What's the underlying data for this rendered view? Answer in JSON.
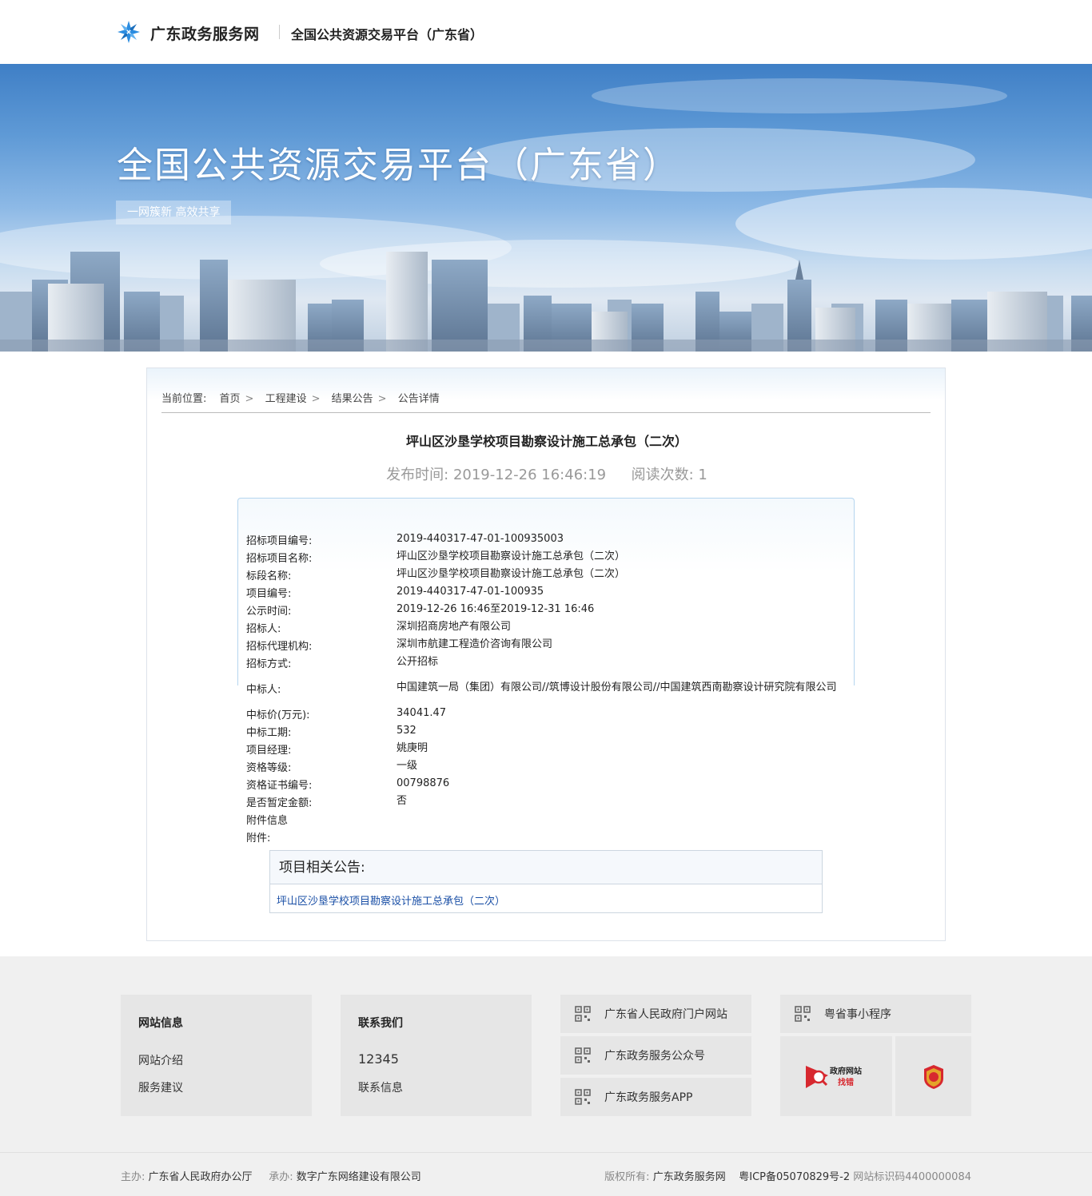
{
  "header": {
    "brand": "广东政务服务网",
    "platform": "全国公共资源交易平台（广东省）"
  },
  "banner": {
    "title": "全国公共资源交易平台（广东省）",
    "tagline": "一网簇新 高效共享"
  },
  "breadcrumb": {
    "prefix": "当前位置:",
    "items": [
      "首页",
      "工程建设",
      "结果公告",
      "公告详情"
    ],
    "separator": ">"
  },
  "notice": {
    "title": "坪山区沙垦学校项目勘察设计施工总承包（二次）",
    "publish_label": "发布时间:",
    "publish_time": "2019-12-26 16:46:19",
    "reads_label": "阅读次数:",
    "reads": "1",
    "fields": [
      {
        "k": "招标项目编号:",
        "v": "2019-440317-47-01-100935003"
      },
      {
        "k": "招标项目名称:",
        "v": "坪山区沙垦学校项目勘察设计施工总承包（二次）"
      },
      {
        "k": "标段名称:",
        "v": "坪山区沙垦学校项目勘察设计施工总承包（二次）"
      },
      {
        "k": "项目编号:",
        "v": "2019-440317-47-01-100935"
      },
      {
        "k": "公示时间:",
        "v": "2019-12-26 16:46至2019-12-31 16:46"
      },
      {
        "k": "招标人:",
        "v": "深圳招商房地产有限公司"
      },
      {
        "k": "招标代理机构:",
        "v": "深圳市航建工程造价咨询有限公司"
      },
      {
        "k": "招标方式:",
        "v": "公开招标"
      },
      {
        "k": "中标人:",
        "v": "中国建筑一局（集团）有限公司//筑博设计股份有限公司//中国建筑西南勘察设计研究院有限公司"
      },
      {
        "k": "中标价(万元):",
        "v": "34041.47"
      },
      {
        "k": "中标工期:",
        "v": "532"
      },
      {
        "k": "项目经理:",
        "v": "姚庚明"
      },
      {
        "k": "资格等级:",
        "v": "一级"
      },
      {
        "k": "资格证书编号:",
        "v": "00798876"
      },
      {
        "k": "是否暂定金额:",
        "v": "否"
      },
      {
        "k": "附件信息",
        "v": ""
      },
      {
        "k": "附件:",
        "v": ""
      }
    ],
    "related_heading": "项目相关公告:",
    "related_link": "坪山区沙垦学校项目勘察设计施工总承包（二次）"
  },
  "footer": {
    "site_info": {
      "heading": "网站信息",
      "links": [
        "网站介绍",
        "服务建议"
      ]
    },
    "contact": {
      "heading": "联系我们",
      "phone": "12345",
      "link": "联系信息"
    },
    "qr_links": [
      "广东省人民政府门户网站",
      "广东政务服务公众号",
      "广东政务服务APP"
    ],
    "mini_program": "粤省事小程序",
    "badge_text": [
      "政府网站",
      "找错"
    ],
    "sponsor_label": "主办:",
    "sponsor": "广东省人民政府办公厅",
    "organizer_label": "承办:",
    "organizer": "数字广东网络建设有限公司",
    "copyright_label": "版权所有:",
    "copyright": "广东政务服务网",
    "icp": "粤ICP备05070829号-2",
    "site_code": "网站标识码4400000084"
  },
  "colors": {
    "link": "#1a4fa6",
    "logo": "#2b8ce0",
    "badge_red": "#d7282f"
  }
}
